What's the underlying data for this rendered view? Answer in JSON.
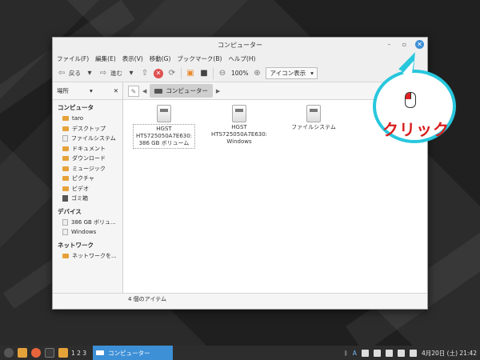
{
  "window": {
    "title": "コンピューター",
    "controls": {
      "minimize": "–",
      "maximize": "▫",
      "close": "✕"
    }
  },
  "menubar": {
    "items": [
      "ファイル(F)",
      "編集(E)",
      "表示(V)",
      "移動(G)",
      "ブックマーク(B)",
      "ヘルプ(H)"
    ]
  },
  "toolbar": {
    "back_label": "戻る",
    "forward_label": "進む",
    "zoom": "100%",
    "view_mode": "アイコン表示"
  },
  "sidebar": {
    "header": "場所",
    "sections": [
      {
        "title": "コンピュータ",
        "items": [
          {
            "label": "taro",
            "icon": "folder-icon"
          },
          {
            "label": "デスクトップ",
            "icon": "folder-icon"
          },
          {
            "label": "ファイルシステム",
            "icon": "drive-icon"
          },
          {
            "label": "ドキュメント",
            "icon": "folder-icon"
          },
          {
            "label": "ダウンロード",
            "icon": "folder-icon"
          },
          {
            "label": "ミュージック",
            "icon": "folder-icon"
          },
          {
            "label": "ピクチャ",
            "icon": "folder-icon"
          },
          {
            "label": "ビデオ",
            "icon": "folder-icon"
          },
          {
            "label": "ゴミ箱",
            "icon": "trash-icon"
          }
        ]
      },
      {
        "title": "デバイス",
        "items": [
          {
            "label": "386 GB ボリュ...",
            "icon": "drive-icon"
          },
          {
            "label": "Windows",
            "icon": "drive-icon"
          }
        ]
      },
      {
        "title": "ネットワーク",
        "items": [
          {
            "label": "ネットワークを...",
            "icon": "folder-icon"
          }
        ]
      }
    ]
  },
  "pathbar": {
    "crumb": "コンピューター"
  },
  "files": [
    {
      "line1": "HGST",
      "line2": "HTS725050A7E630:",
      "line3": "386 GB ボリューム",
      "selected": true
    },
    {
      "line1": "HGST",
      "line2": "HTS725050A7E630:",
      "line3": "Windows",
      "selected": false
    },
    {
      "line1": "ファイルシステム",
      "line2": "",
      "line3": "",
      "selected": false
    }
  ],
  "status": "4 個のアイテム",
  "callout": {
    "text": "クリック"
  },
  "taskbar": {
    "workspaces": "1 2 3",
    "task_label": "コンピューター",
    "clock": "4月20日 (土) 21:42",
    "keyboard": "A"
  },
  "colors": {
    "accent": "#3d8fd6",
    "callout_border": "#27c7dd",
    "callout_text": "#d81e1e"
  }
}
